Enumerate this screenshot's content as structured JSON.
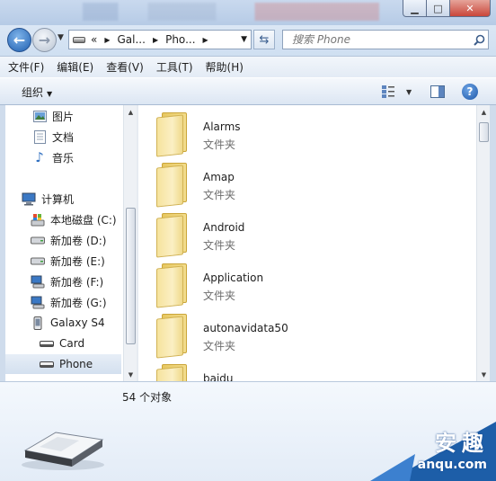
{
  "address": {
    "crumbs": [
      "«",
      "Gal...",
      "Pho..."
    ],
    "search_placeholder": "搜索 Phone"
  },
  "menu": [
    "文件(F)",
    "编辑(E)",
    "查看(V)",
    "工具(T)",
    "帮助(H)"
  ],
  "toolbar": {
    "organize_label": "组织"
  },
  "nav": {
    "items": [
      {
        "label": "图片",
        "icon": "pictures-icon"
      },
      {
        "label": "文档",
        "icon": "documents-icon"
      },
      {
        "label": "音乐",
        "icon": "music-icon"
      },
      {
        "label": "计算机",
        "icon": "computer-icon"
      },
      {
        "label": "本地磁盘 (C:)",
        "icon": "system-drive-icon"
      },
      {
        "label": "新加卷 (D:)",
        "icon": "drive-icon"
      },
      {
        "label": "新加卷 (E:)",
        "icon": "drive-icon"
      },
      {
        "label": "新加卷 (F:)",
        "icon": "network-drive-icon"
      },
      {
        "label": "新加卷 (G:)",
        "icon": "network-drive-icon"
      },
      {
        "label": "Galaxy S4",
        "icon": "phone-icon"
      },
      {
        "label": "Card",
        "icon": "storage-icon"
      },
      {
        "label": "Phone",
        "icon": "storage-icon",
        "selected": true
      }
    ]
  },
  "files": [
    {
      "name": "Alarms",
      "type": "文件夹"
    },
    {
      "name": "Amap",
      "type": "文件夹"
    },
    {
      "name": "Android",
      "type": "文件夹"
    },
    {
      "name": "Application",
      "type": "文件夹"
    },
    {
      "name": "autonavidata50",
      "type": "文件夹"
    },
    {
      "name": "baidu",
      "type": ""
    }
  ],
  "details": {
    "item_count": "54 个对象"
  },
  "watermark": {
    "logo": "安趣",
    "url": "anqu.com"
  },
  "colors": {
    "accent": "#1f5fb0",
    "folder": "#f2dc8c",
    "close": "#c9463a"
  }
}
